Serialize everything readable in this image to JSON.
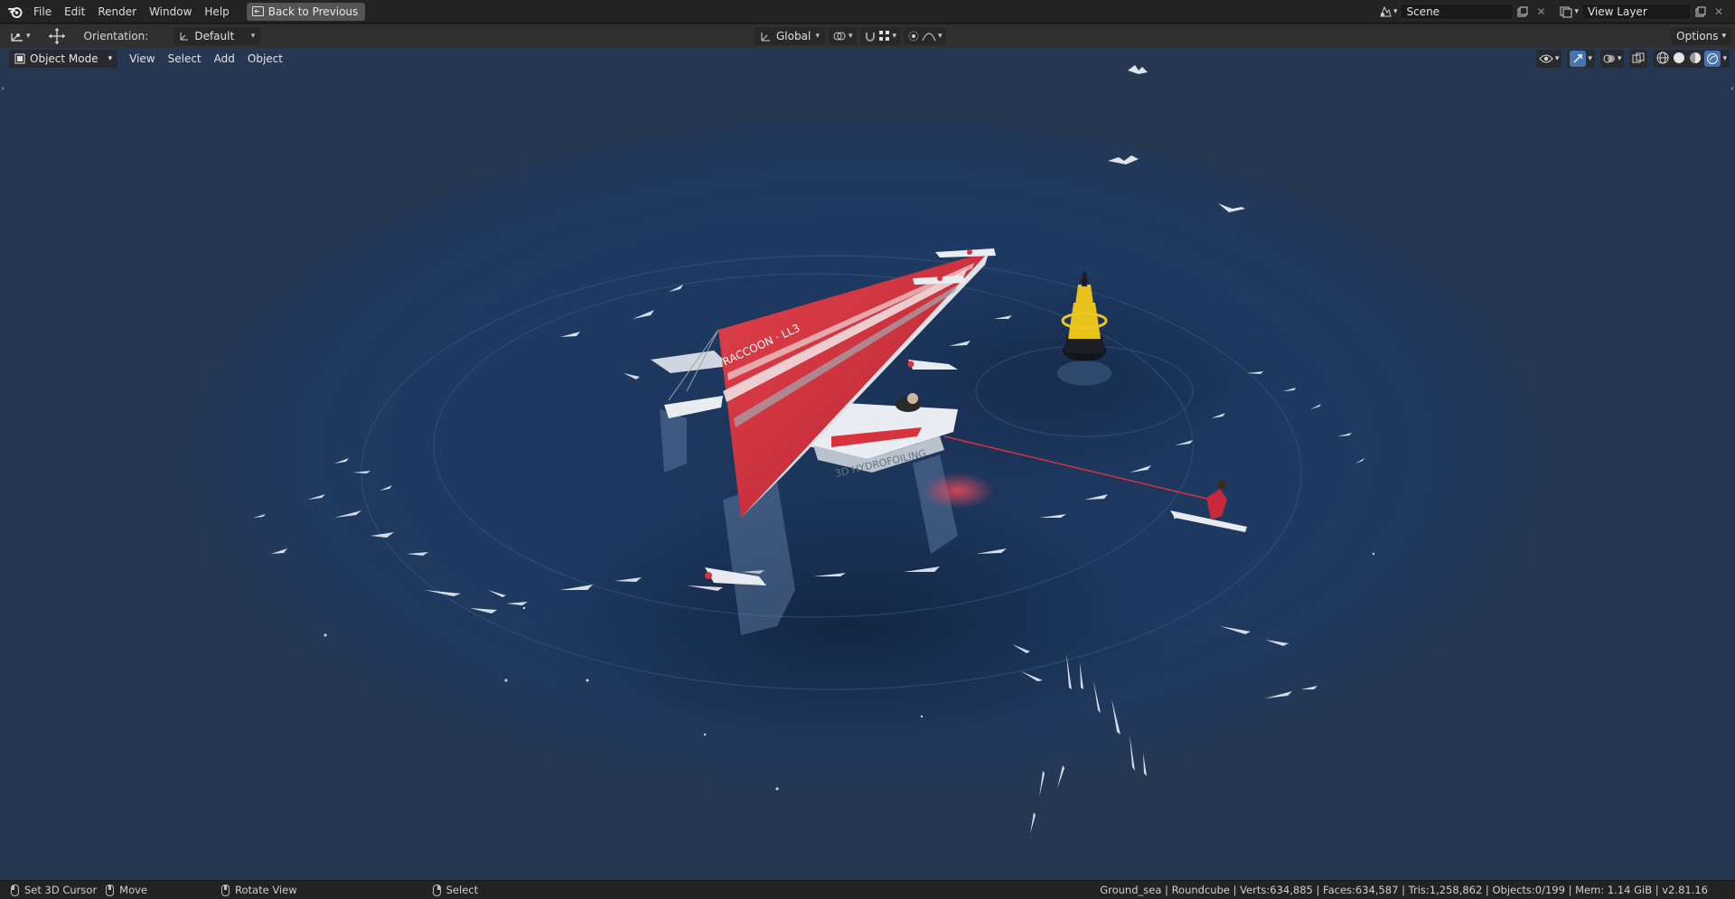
{
  "topbar": {
    "menu": [
      "File",
      "Edit",
      "Render",
      "Window",
      "Help"
    ],
    "back_button": "Back to Previous",
    "scene_field": "Scene",
    "view_layer_field": "View Layer"
  },
  "toolheader": {
    "orientation_label": "Orientation:",
    "orientation_value": "Default",
    "transform_orientation": "Global",
    "options_label": "Options"
  },
  "viewport": {
    "mode": "Object Mode",
    "menu": [
      "View",
      "Select",
      "Add",
      "Object"
    ],
    "hull_text": "RACCOON · LL3",
    "hull_text_2": "3D HYDROFOILING"
  },
  "statusbar": {
    "set_cursor": "Set 3D Cursor",
    "move": "Move",
    "rotate_view": "Rotate View",
    "select": "Select",
    "stats": "Ground_sea | Roundcube | Verts:634,885 | Faces:634,587 | Tris:1,258,862 | Objects:0/199 | Mem: 1.14 GiB | v2.81.16"
  },
  "colors": {
    "viewport_bg": "#263751",
    "sea": "#1e3659",
    "sail_red": "#d8333d",
    "buoy_yellow": "#e7c21a",
    "header_bg": "#303030"
  }
}
